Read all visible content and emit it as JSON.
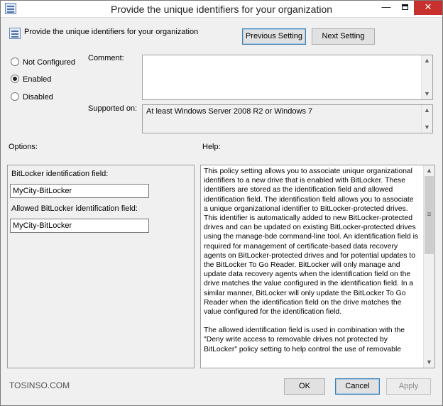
{
  "window": {
    "title": "Provide the unique identifiers for your organization",
    "minimize_glyph": "—",
    "close_glyph": "✕"
  },
  "header": {
    "title": "Provide the unique identifiers for your organization",
    "previous_label": "Previous Setting",
    "next_label": "Next Setting"
  },
  "state": {
    "options": [
      "Not Configured",
      "Enabled",
      "Disabled"
    ],
    "selected": "Enabled"
  },
  "comment": {
    "label": "Comment:",
    "value": ""
  },
  "supported": {
    "label": "Supported on:",
    "value": "At least Windows Server 2008 R2 or Windows 7"
  },
  "sections": {
    "options_label": "Options:",
    "help_label": "Help:"
  },
  "options": {
    "id_field_label": "BitLocker identification field:",
    "id_field_value": "MyCity-BitLocker",
    "allowed_field_label": "Allowed BitLocker identification field:",
    "allowed_field_value": "MyCity-BitLocker"
  },
  "help": {
    "paragraph1": "This policy setting allows you to associate unique organizational identifiers to a new drive that is enabled with BitLocker. These identifiers are stored as the identification field and allowed identification field. The identification field allows you to associate a unique organizational identifier to BitLocker-protected drives. This identifier is automatically added to new BitLocker-protected drives and can be updated on existing BitLocker-protected drives using the manage-bde command-line tool. An identification field is required for management of certificate-based data recovery agents on BitLocker-protected drives and for potential updates to the BitLocker To Go Reader. BitLocker will only manage and update data recovery agents when the identification field on the drive matches the value configured in the identification field. In a similar manner, BitLocker will only update the BitLocker To Go Reader when the identification field on the drive matches the value configured for the identification field.",
    "paragraph2": "The allowed identification field is used in combination with the \"Deny write access to removable drives not protected by BitLocker\" policy setting to help control the use of removable"
  },
  "footer": {
    "ok_label": "OK",
    "cancel_label": "Cancel",
    "apply_label": "Apply"
  },
  "watermark": {
    "text": "TOSINSO.COM"
  },
  "icons": {
    "scroll_up": "▲",
    "scroll_down": "▼",
    "thumb_grip": "≡"
  }
}
